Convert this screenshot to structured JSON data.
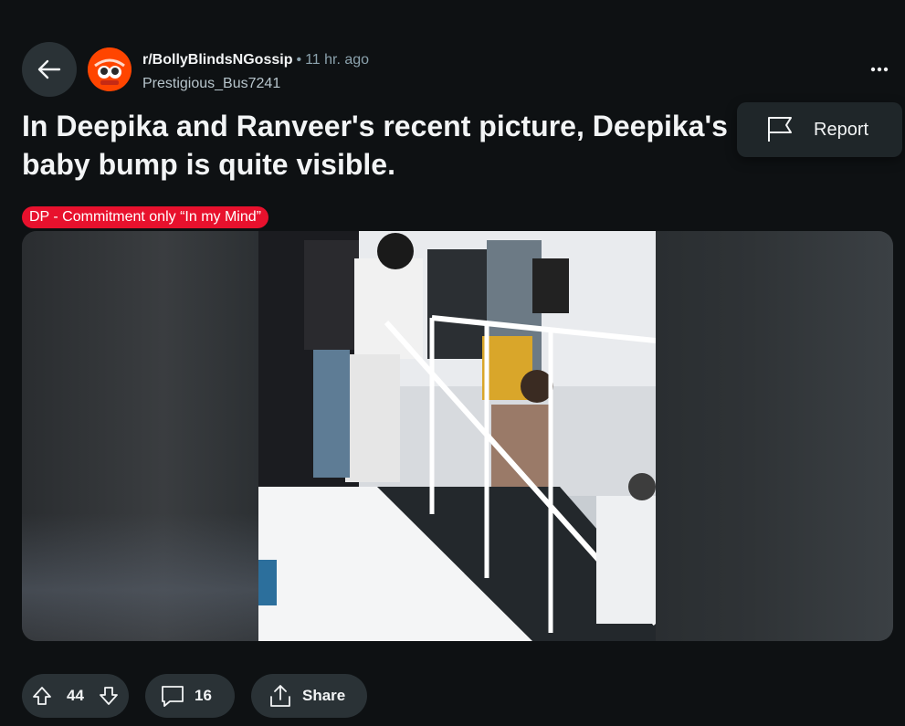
{
  "header": {
    "subreddit": "r/BollyBlindsNGossip",
    "separator": "•",
    "time_ago": "11 hr. ago",
    "username": "Prestigious_Bus7241"
  },
  "post": {
    "title": "In Deepika and Ranveer's recent picture, Deepika's baby bump is quite visible.",
    "flair": "DP - Commitment only “In my Mind”"
  },
  "menu": {
    "report_label": "Report"
  },
  "actions": {
    "upvotes": "44",
    "comments": "16",
    "share_label": "Share"
  },
  "icons": {
    "back": "arrow-left-icon",
    "more": "ellipsis-icon",
    "report": "flag-icon",
    "upvote": "arrow-up-icon",
    "downvote": "arrow-down-icon",
    "comment": "speech-bubble-icon",
    "share": "share-icon"
  },
  "colors": {
    "background": "#0e1113",
    "button_bg": "#2a3236",
    "flair_bg": "#e8112d",
    "avatar_bg": "#ff4500"
  }
}
